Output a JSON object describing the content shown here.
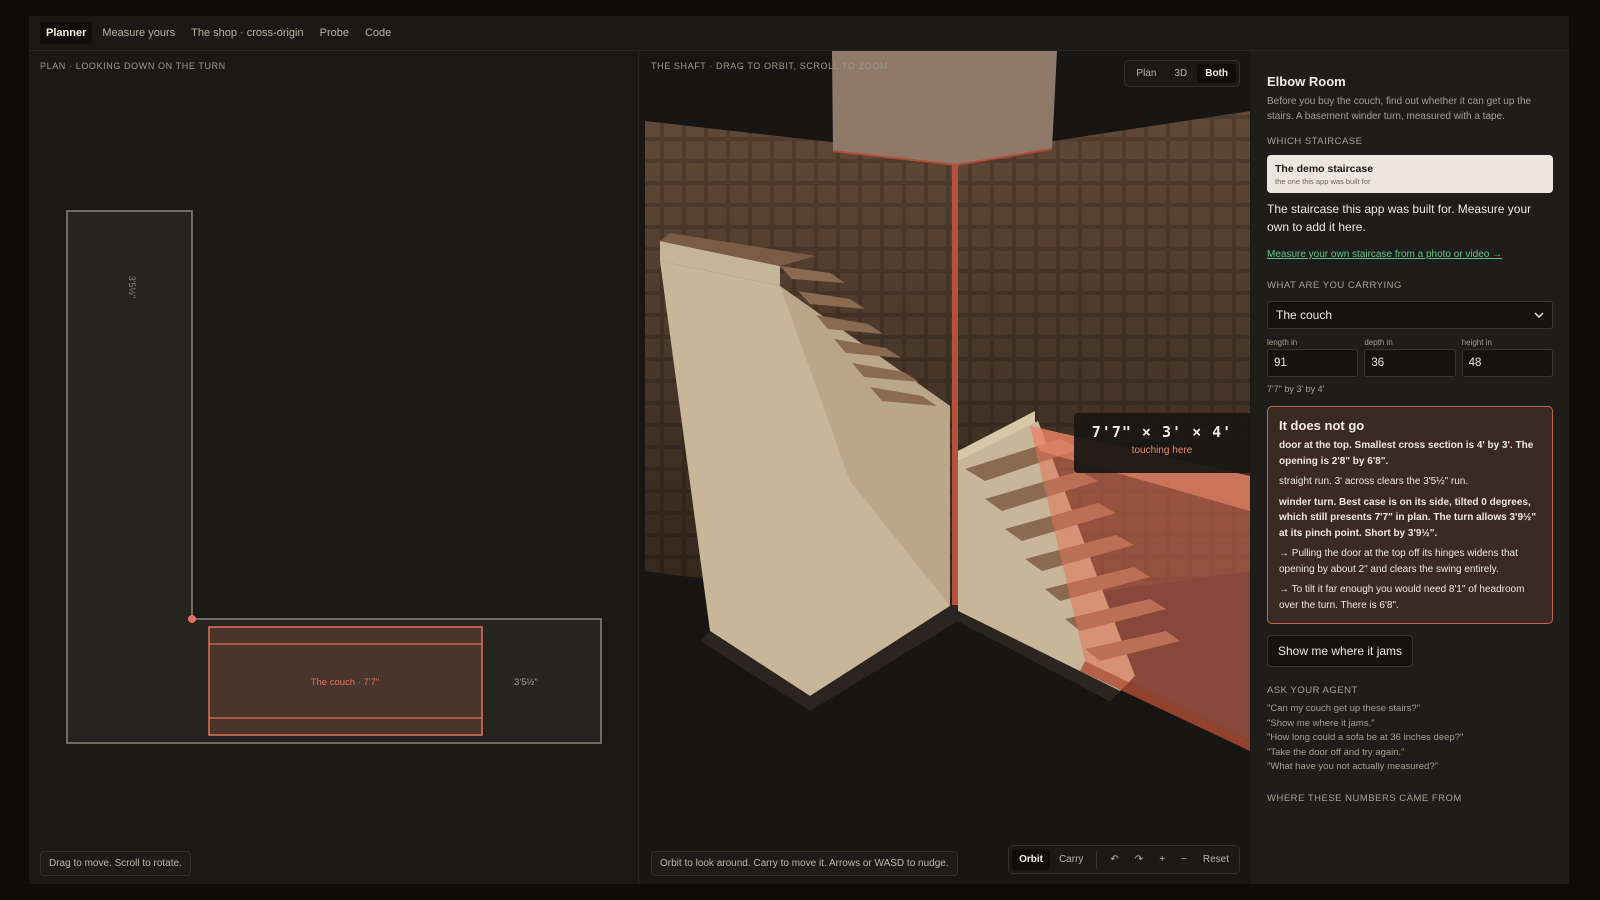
{
  "nav": {
    "tabs": [
      {
        "label": "Planner",
        "active": true
      },
      {
        "label": "Measure yours"
      },
      {
        "label": "The shop · cross-origin"
      },
      {
        "label": "Probe"
      },
      {
        "label": "Code"
      }
    ]
  },
  "plan": {
    "caption": "PLAN · LOOKING DOWN ON THE TURN",
    "vertical_dim": "3'5½\"",
    "couch_label": "The couch · 7'7\"",
    "horizontal_dim": "3'5½\"",
    "hint": "Drag to move. Scroll to rotate."
  },
  "shaft": {
    "caption": "THE SHAFT · DRAG TO ORBIT, SCROLL TO ZOOM",
    "view_toggle": [
      "Plan",
      "3D",
      "Both"
    ],
    "active_view": "Both",
    "fit_dims": "7'7\" × 3' × 4'",
    "fit_note": "touching here",
    "hint": "Orbit to look around. Carry to move it. Arrows or WASD to nudge.",
    "controls": {
      "orbit": "Orbit",
      "carry": "Carry",
      "undo": "↶",
      "redo": "↷",
      "zoom_in": "+",
      "zoom_out": "−",
      "reset": "Reset"
    }
  },
  "side": {
    "title": "Elbow Room",
    "intro": "Before you buy the couch, find out whether it can get up the stairs. A basement winder turn, measured with a tape.",
    "which_staircase": "WHICH STAIRCASE",
    "card_title": "The demo staircase",
    "card_sub": "the one this app was built for",
    "para": "The staircase this app was built for. Measure your own to add it here.",
    "link": "Measure your own staircase from a photo or video →",
    "carrying": "WHAT ARE YOU CARRYING",
    "item": "The couch",
    "dims": [
      {
        "label": "length in",
        "value": "91"
      },
      {
        "label": "depth in",
        "value": "36"
      },
      {
        "label": "height in",
        "value": "48"
      }
    ],
    "dim_summary": "7'7\" by 3' by 4'",
    "verdict_title": "It does not go",
    "verdict_1": "door at the top. Smallest cross section is 4' by 3'. The opening is 2'8\" by 6'8\".",
    "verdict_2": "straight run. 3' across clears the 3'5½\" run.",
    "verdict_3": "winder turn. Best case is on its side, tilted 0 degrees, which still presents 7'7\" in plan. The turn allows 3'9½\" at its pinch point. Short by 3'9½\".",
    "verdict_4": "→ Pulling the door at the top off its hinges widens that opening by about 2\" and clears the swing entirely.",
    "verdict_5": "→ To tilt it far enough you would need 8'1\" of headroom over the turn. There is 6'8\".",
    "jam_button": "Show me where it jams",
    "ask_agent": "ASK YOUR AGENT",
    "questions": [
      "\"Can my couch get up these stairs?\"",
      "\"Show me where it jams.\"",
      "\"How long could a sofa be at 36 inches deep?\"",
      "\"Take the door off and try again.\"",
      "\"What have you not actually measured?\""
    ],
    "numbers_from": "WHERE THESE NUMBERS CAME FROM"
  },
  "colors": {
    "accent": "#e4735a",
    "link": "#62c48a",
    "verdict_bg": "#3b2a24"
  }
}
